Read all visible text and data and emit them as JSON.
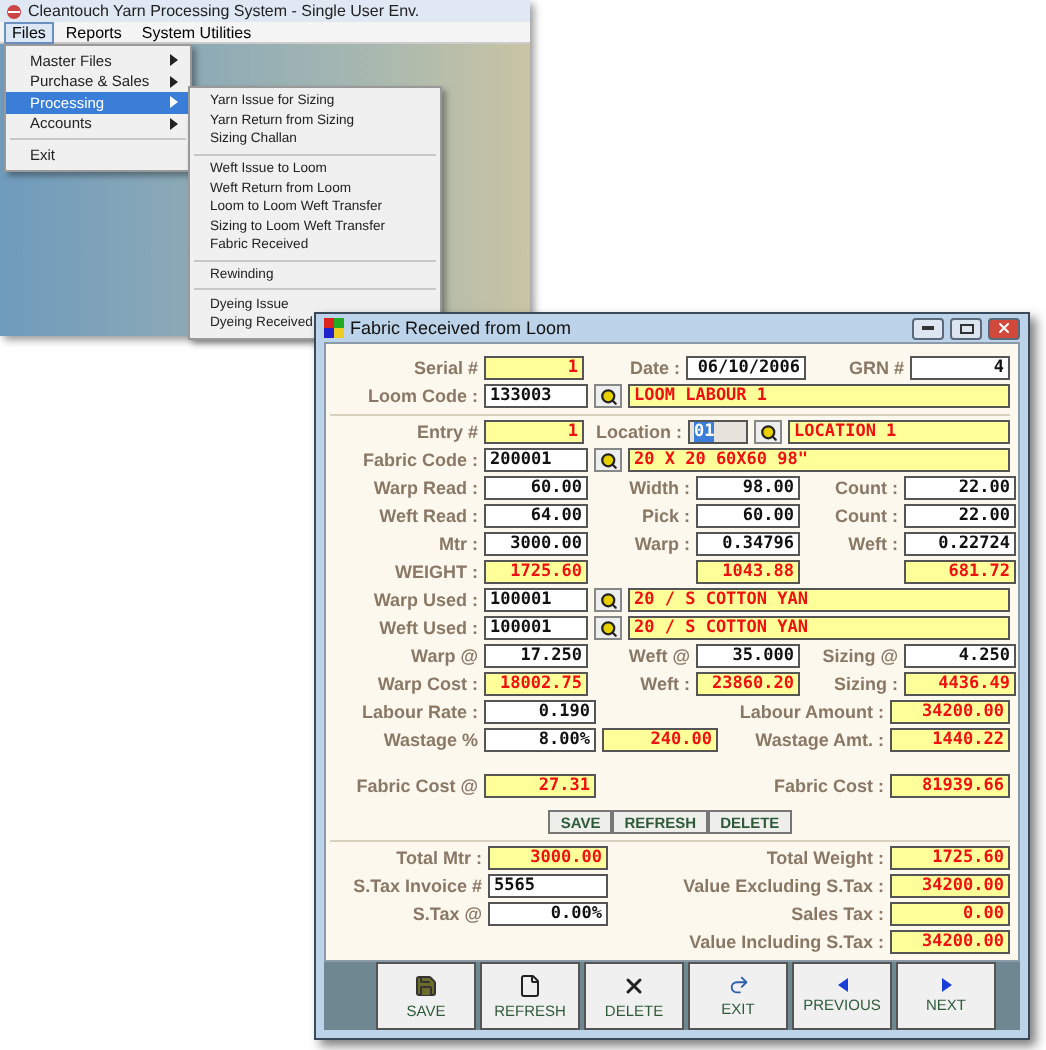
{
  "app_window": {
    "title": "Cleantouch Yarn Processing System - Single User Env.",
    "menu_bar": [
      {
        "label": "Files",
        "selected": true
      },
      {
        "label": "Reports",
        "selected": false
      },
      {
        "label": "System Utilities",
        "selected": false
      }
    ],
    "files_menu": [
      {
        "kind": "item",
        "label": "Master Files",
        "has_submenu": true,
        "selected": false
      },
      {
        "kind": "item",
        "label": "Purchase & Sales",
        "has_submenu": true,
        "selected": false
      },
      {
        "kind": "item",
        "label": "Processing",
        "has_submenu": true,
        "selected": true
      },
      {
        "kind": "item",
        "label": "Accounts",
        "has_submenu": true,
        "selected": false
      },
      {
        "kind": "separator"
      },
      {
        "kind": "item",
        "label": "Exit",
        "has_submenu": false,
        "selected": false
      }
    ],
    "processing_submenu": [
      {
        "kind": "item",
        "label": "Yarn Issue for Sizing"
      },
      {
        "kind": "item",
        "label": "Yarn Return from Sizing"
      },
      {
        "kind": "item",
        "label": "Sizing Challan"
      },
      {
        "kind": "separator"
      },
      {
        "kind": "item",
        "label": "Weft Issue to Loom"
      },
      {
        "kind": "item",
        "label": "Weft Return from Loom"
      },
      {
        "kind": "item",
        "label": "Loom to Loom Weft Transfer"
      },
      {
        "kind": "item",
        "label": "Sizing to Loom Weft Transfer"
      },
      {
        "kind": "item",
        "label": "Fabric Received"
      },
      {
        "kind": "separator"
      },
      {
        "kind": "item",
        "label": "Rewinding"
      },
      {
        "kind": "separator"
      },
      {
        "kind": "item",
        "label": "Dyeing Issue"
      },
      {
        "kind": "item",
        "label": "Dyeing Received"
      }
    ]
  },
  "form_window": {
    "title": "Fabric Received from Loom",
    "sections": [
      {
        "rows": [
          {
            "kind": "header",
            "fields": [
              {
                "kind": "label",
                "text": "Serial #"
              },
              {
                "kind": "output",
                "text": "1"
              },
              {
                "kind": "label",
                "text": "Date :"
              },
              {
                "kind": "input",
                "text": "06/10/2006"
              },
              {
                "kind": "label",
                "text": "GRN #"
              },
              {
                "kind": "input",
                "text": "4"
              }
            ]
          },
          {
            "kind": "lookup",
            "fields": [
              {
                "kind": "label",
                "text": "Loom Code :"
              },
              {
                "kind": "text_input",
                "text": "133003"
              },
              {
                "kind": "lookup"
              },
              {
                "kind": "desc",
                "text": "LOOM LABOUR 1"
              }
            ]
          }
        ]
      },
      {
        "rows": [
          {
            "kind": "entry",
            "fields": [
              {
                "kind": "label",
                "text": "Entry #"
              },
              {
                "kind": "output",
                "text": "1"
              },
              {
                "kind": "label",
                "text": "Location :"
              },
              {
                "kind": "focused",
                "text": "01"
              },
              {
                "kind": "lookup"
              },
              {
                "kind": "desc",
                "text": "LOCATION 1"
              }
            ]
          },
          {
            "kind": "lookup",
            "fields": [
              {
                "kind": "label",
                "text": "Fabric Code :"
              },
              {
                "kind": "text_input",
                "text": "200001"
              },
              {
                "kind": "lookup"
              },
              {
                "kind": "desc",
                "text": "20 X 20 60X60 98\""
              }
            ]
          },
          {
            "kind": "triple",
            "fields": [
              {
                "kind": "label",
                "text": "Warp Read :"
              },
              {
                "kind": "input",
                "text": "60.00"
              },
              {
                "kind": "label",
                "text": "Width :"
              },
              {
                "kind": "input",
                "text": "98.00"
              },
              {
                "kind": "label",
                "text": "Count :"
              },
              {
                "kind": "input",
                "text": "22.00"
              }
            ]
          },
          {
            "kind": "triple",
            "fields": [
              {
                "kind": "label",
                "text": "Weft Read :"
              },
              {
                "kind": "input",
                "text": "64.00"
              },
              {
                "kind": "label",
                "text": "Pick :"
              },
              {
                "kind": "input",
                "text": "60.00"
              },
              {
                "kind": "label",
                "text": "Count :"
              },
              {
                "kind": "input",
                "text": "22.00"
              }
            ]
          },
          {
            "kind": "triple",
            "fields": [
              {
                "kind": "label",
                "text": "Mtr :"
              },
              {
                "kind": "input",
                "text": "3000.00"
              },
              {
                "kind": "label",
                "text": "Warp :"
              },
              {
                "kind": "input",
                "text": "0.34796"
              },
              {
                "kind": "label",
                "text": "Weft :"
              },
              {
                "kind": "input",
                "text": "0.22724"
              }
            ]
          },
          {
            "kind": "triple",
            "fields": [
              {
                "kind": "label",
                "text": "WEIGHT :"
              },
              {
                "kind": "output",
                "text": "1725.60"
              },
              {
                "kind": "blank"
              },
              {
                "kind": "output",
                "text": "1043.88"
              },
              {
                "kind": "blank"
              },
              {
                "kind": "output",
                "text": "681.72"
              }
            ]
          },
          {
            "kind": "lookup",
            "fields": [
              {
                "kind": "label",
                "text": "Warp Used :"
              },
              {
                "kind": "text_input",
                "text": "100001"
              },
              {
                "kind": "lookup"
              },
              {
                "kind": "desc",
                "text": "20 / S COTTON YAN"
              }
            ]
          },
          {
            "kind": "lookup",
            "fields": [
              {
                "kind": "label",
                "text": "Weft Used :"
              },
              {
                "kind": "text_input",
                "text": "100001"
              },
              {
                "kind": "lookup"
              },
              {
                "kind": "desc",
                "text": "20 / S COTTON YAN"
              }
            ]
          },
          {
            "kind": "triple",
            "fields": [
              {
                "kind": "label",
                "text": "Warp @"
              },
              {
                "kind": "input",
                "text": "17.250"
              },
              {
                "kind": "label",
                "text": "Weft @"
              },
              {
                "kind": "input",
                "text": "35.000"
              },
              {
                "kind": "label",
                "text": "Sizing @"
              },
              {
                "kind": "input",
                "text": "4.250"
              }
            ]
          },
          {
            "kind": "triple",
            "fields": [
              {
                "kind": "label",
                "text": "Warp Cost :"
              },
              {
                "kind": "output",
                "text": "18002.75"
              },
              {
                "kind": "label",
                "text": "Weft :"
              },
              {
                "kind": "output",
                "text": "23860.20"
              },
              {
                "kind": "label",
                "text": "Sizing :"
              },
              {
                "kind": "output",
                "text": "4436.49"
              }
            ]
          },
          {
            "kind": "pair",
            "fields": [
              {
                "kind": "label",
                "text": "Labour Rate :"
              },
              {
                "kind": "input",
                "text": "0.190"
              },
              {
                "kind": "label",
                "text": "Labour Amount :"
              },
              {
                "kind": "output",
                "text": "34200.00"
              }
            ]
          },
          {
            "kind": "wastage",
            "fields": [
              {
                "kind": "label",
                "text": "Wastage %"
              },
              {
                "kind": "input",
                "text": "8.00%"
              },
              {
                "kind": "output",
                "text": "240.00"
              },
              {
                "kind": "label",
                "text": "Wastage Amt. :"
              },
              {
                "kind": "output",
                "text": "1440.22"
              }
            ]
          },
          {
            "kind": "cost",
            "fields": [
              {
                "kind": "label",
                "text": "Fabric Cost @"
              },
              {
                "kind": "output",
                "text": "27.31"
              },
              {
                "kind": "label",
                "text": "Fabric Cost :"
              },
              {
                "kind": "output",
                "text": "81939.66"
              }
            ]
          }
        ],
        "buttons": [
          "SAVE",
          "REFRESH",
          "DELETE"
        ]
      },
      {
        "rows": [
          {
            "kind": "totals",
            "fields": [
              {
                "kind": "label",
                "text": "Total Mtr :"
              },
              {
                "kind": "output",
                "text": "3000.00"
              },
              {
                "kind": "label",
                "text": "Total Weight :"
              },
              {
                "kind": "output",
                "text": "1725.60"
              }
            ]
          },
          {
            "kind": "totals",
            "fields": [
              {
                "kind": "label",
                "text": "S.Tax Invoice #"
              },
              {
                "kind": "text_input",
                "text": "5565"
              },
              {
                "kind": "label",
                "text": "Value Excluding S.Tax :"
              },
              {
                "kind": "output",
                "text": "34200.00"
              }
            ]
          },
          {
            "kind": "totals",
            "fields": [
              {
                "kind": "label",
                "text": "S.Tax @"
              },
              {
                "kind": "input",
                "text": "0.00%"
              },
              {
                "kind": "label",
                "text": "Sales Tax :"
              },
              {
                "kind": "output",
                "text": "0.00"
              }
            ]
          },
          {
            "kind": "totals",
            "fields": [
              {
                "kind": "blank"
              },
              {
                "kind": "blank"
              },
              {
                "kind": "label",
                "text": "Value Including S.Tax :"
              },
              {
                "kind": "output",
                "text": "34200.00"
              }
            ]
          }
        ]
      }
    ],
    "toolbar": [
      {
        "kind": "save",
        "label": "SAVE"
      },
      {
        "kind": "refresh",
        "label": "REFRESH"
      },
      {
        "kind": "delete",
        "label": "DELETE"
      },
      {
        "kind": "exit",
        "label": "EXIT"
      },
      {
        "kind": "previous",
        "label": "PREVIOUS"
      },
      {
        "kind": "next",
        "label": "NEXT"
      }
    ]
  }
}
